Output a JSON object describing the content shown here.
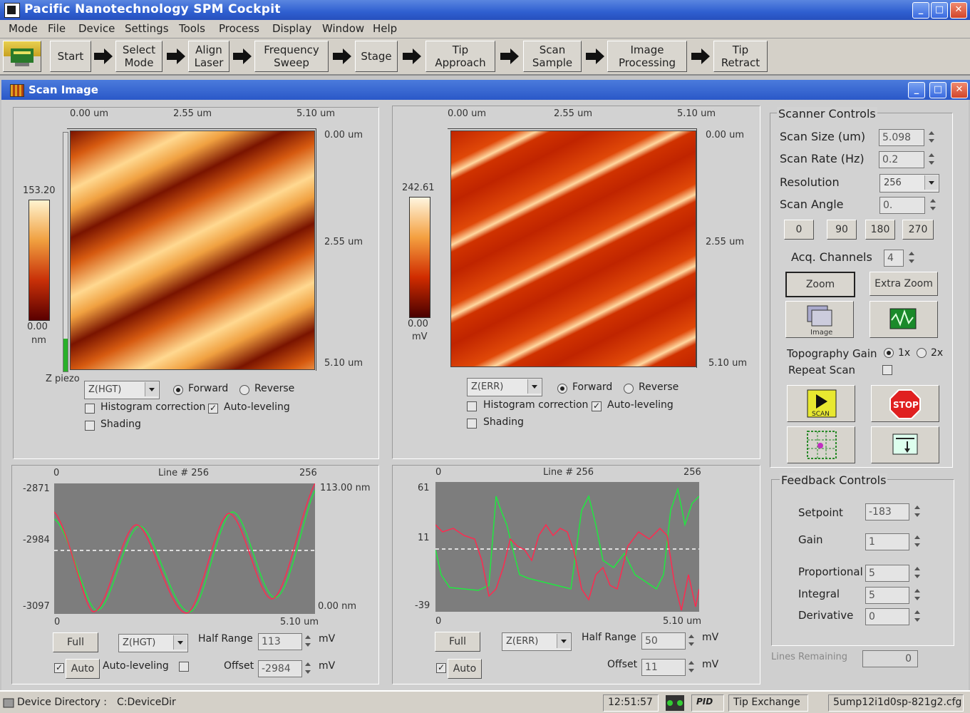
{
  "app": {
    "title": "Pacific Nanotechnology SPM Cockpit"
  },
  "menu": [
    "Mode",
    "File",
    "Device",
    "Settings",
    "Tools",
    "Process",
    "Display",
    "Window",
    "Help"
  ],
  "toolbar": {
    "buttons": [
      "Start",
      "Select\nMode",
      "Align\nLaser",
      "Frequency\nSweep",
      "Stage",
      "Tip\nApproach",
      "Scan\nSample",
      "Image\nProcessing",
      "Tip\nRetract"
    ]
  },
  "scan_window": {
    "title": "Scan Image"
  },
  "left_image": {
    "xticks": [
      "0.00 um",
      "2.55 um",
      "5.10 um"
    ],
    "yticks": [
      "0.00 um",
      "2.55 um",
      "5.10 um"
    ],
    "scale_max": "153.20",
    "scale_min": "0.00",
    "scale_unit": "nm",
    "z_label": "Z piezo",
    "channel": "Z(HGT)",
    "forward": "Forward",
    "reverse": "Reverse",
    "histogram": "Histogram correction",
    "autolevel": "Auto-leveling",
    "shading": "Shading"
  },
  "right_image": {
    "xticks": [
      "0.00 um",
      "2.55 um",
      "5.10 um"
    ],
    "yticks": [
      "0.00 um",
      "2.55 um",
      "5.10 um"
    ],
    "scale_max": "242.61",
    "scale_min": "0.00",
    "scale_unit": "mV",
    "channel": "Z(ERR)",
    "forward": "Forward",
    "reverse": "Reverse",
    "histogram": "Histogram correction",
    "autolevel": "Auto-leveling",
    "shading": "Shading"
  },
  "left_line": {
    "x_start": "0",
    "line_label": "Line # 256",
    "x_end": "256",
    "y_top": "-2871",
    "y_mid": "-2984",
    "y_bot": "-3097",
    "right_top": "113.00 nm",
    "right_bot": "0.00 nm",
    "bottom_start": "0",
    "bottom_end": "5.10 um",
    "full": "Full",
    "channel": "Z(HGT)",
    "half_range_label": "Half Range",
    "half_range": "113",
    "unit": "mV",
    "auto": "Auto",
    "autolevel": "Auto-leveling",
    "offset_label": "Offset",
    "offset": "-2984"
  },
  "right_line": {
    "x_start": "0",
    "line_label": "Line # 256",
    "x_end": "256",
    "y_top": "61",
    "y_mid": "11",
    "y_bot": "-39",
    "bottom_start": "0",
    "bottom_end": "5.10 um",
    "full": "Full",
    "channel": "Z(ERR)",
    "half_range_label": "Half Range",
    "half_range": "50",
    "unit": "mV",
    "auto": "Auto",
    "offset_label": "Offset",
    "offset": "11"
  },
  "scanner": {
    "title": "Scanner Controls",
    "scan_size_label": "Scan Size (um)",
    "scan_size": "5.098",
    "scan_rate_label": "Scan Rate (Hz)",
    "scan_rate": "0.2",
    "resolution_label": "Resolution",
    "resolution": "256",
    "angle_label": "Scan Angle",
    "angle": "0.",
    "angles": [
      "0",
      "90",
      "180",
      "270"
    ],
    "acq_label": "Acq. Channels",
    "acq": "4",
    "zoom": "Zoom",
    "extra_zoom": "Extra Zoom",
    "image_icon_text": "Image",
    "topo_gain_label": "Topography Gain",
    "gain_1x": "1x",
    "gain_2x": "2x",
    "repeat_label": "Repeat Scan",
    "scan_btn_text": "SCAN",
    "stop_text": "STOP"
  },
  "feedback": {
    "title": "Feedback Controls",
    "setpoint_label": "Setpoint",
    "setpoint": "-183",
    "gain_label": "Gain",
    "gain": "1",
    "prop_label": "Proportional",
    "prop": "5",
    "integral_label": "Integral",
    "integral": "5",
    "deriv_label": "Derivative",
    "deriv": "0",
    "lines_label": "Lines Remaining",
    "lines": "0"
  },
  "status": {
    "dir_label": "Device Directory :",
    "dir": "C:DeviceDir",
    "time": "12:51:57",
    "pid": "PID",
    "tip_exchange": "Tip Exchange",
    "config": "5ump12i1d0sp-821g2.cfg"
  },
  "colors": {
    "hgt_scale": [
      "#5a0000",
      "#c83008",
      "#f09a30",
      "#fff4d0"
    ],
    "err_scale": [
      "#4a0000",
      "#d02c00",
      "#f4a040",
      "#fff6e0"
    ],
    "trace_forward": "#ff2a50",
    "trace_reverse": "#20e840"
  }
}
